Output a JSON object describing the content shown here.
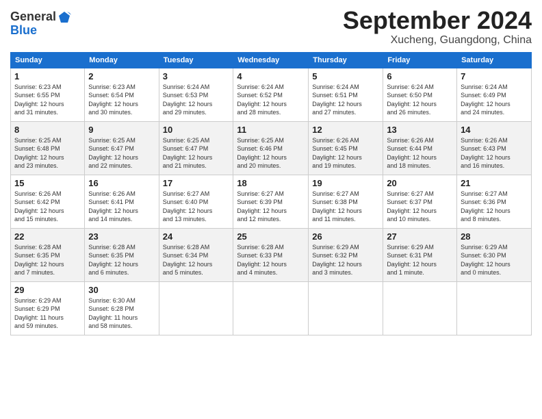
{
  "header": {
    "logo_general": "General",
    "logo_blue": "Blue",
    "month": "September 2024",
    "location": "Xucheng, Guangdong, China"
  },
  "columns": [
    "Sunday",
    "Monday",
    "Tuesday",
    "Wednesday",
    "Thursday",
    "Friday",
    "Saturday"
  ],
  "weeks": [
    [
      {
        "day": "1",
        "info": "Sunrise: 6:23 AM\nSunset: 6:55 PM\nDaylight: 12 hours\nand 31 minutes."
      },
      {
        "day": "2",
        "info": "Sunrise: 6:23 AM\nSunset: 6:54 PM\nDaylight: 12 hours\nand 30 minutes."
      },
      {
        "day": "3",
        "info": "Sunrise: 6:24 AM\nSunset: 6:53 PM\nDaylight: 12 hours\nand 29 minutes."
      },
      {
        "day": "4",
        "info": "Sunrise: 6:24 AM\nSunset: 6:52 PM\nDaylight: 12 hours\nand 28 minutes."
      },
      {
        "day": "5",
        "info": "Sunrise: 6:24 AM\nSunset: 6:51 PM\nDaylight: 12 hours\nand 27 minutes."
      },
      {
        "day": "6",
        "info": "Sunrise: 6:24 AM\nSunset: 6:50 PM\nDaylight: 12 hours\nand 26 minutes."
      },
      {
        "day": "7",
        "info": "Sunrise: 6:24 AM\nSunset: 6:49 PM\nDaylight: 12 hours\nand 24 minutes."
      }
    ],
    [
      {
        "day": "8",
        "info": "Sunrise: 6:25 AM\nSunset: 6:48 PM\nDaylight: 12 hours\nand 23 minutes."
      },
      {
        "day": "9",
        "info": "Sunrise: 6:25 AM\nSunset: 6:47 PM\nDaylight: 12 hours\nand 22 minutes."
      },
      {
        "day": "10",
        "info": "Sunrise: 6:25 AM\nSunset: 6:47 PM\nDaylight: 12 hours\nand 21 minutes."
      },
      {
        "day": "11",
        "info": "Sunrise: 6:25 AM\nSunset: 6:46 PM\nDaylight: 12 hours\nand 20 minutes."
      },
      {
        "day": "12",
        "info": "Sunrise: 6:26 AM\nSunset: 6:45 PM\nDaylight: 12 hours\nand 19 minutes."
      },
      {
        "day": "13",
        "info": "Sunrise: 6:26 AM\nSunset: 6:44 PM\nDaylight: 12 hours\nand 18 minutes."
      },
      {
        "day": "14",
        "info": "Sunrise: 6:26 AM\nSunset: 6:43 PM\nDaylight: 12 hours\nand 16 minutes."
      }
    ],
    [
      {
        "day": "15",
        "info": "Sunrise: 6:26 AM\nSunset: 6:42 PM\nDaylight: 12 hours\nand 15 minutes."
      },
      {
        "day": "16",
        "info": "Sunrise: 6:26 AM\nSunset: 6:41 PM\nDaylight: 12 hours\nand 14 minutes."
      },
      {
        "day": "17",
        "info": "Sunrise: 6:27 AM\nSunset: 6:40 PM\nDaylight: 12 hours\nand 13 minutes."
      },
      {
        "day": "18",
        "info": "Sunrise: 6:27 AM\nSunset: 6:39 PM\nDaylight: 12 hours\nand 12 minutes."
      },
      {
        "day": "19",
        "info": "Sunrise: 6:27 AM\nSunset: 6:38 PM\nDaylight: 12 hours\nand 11 minutes."
      },
      {
        "day": "20",
        "info": "Sunrise: 6:27 AM\nSunset: 6:37 PM\nDaylight: 12 hours\nand 10 minutes."
      },
      {
        "day": "21",
        "info": "Sunrise: 6:27 AM\nSunset: 6:36 PM\nDaylight: 12 hours\nand 8 minutes."
      }
    ],
    [
      {
        "day": "22",
        "info": "Sunrise: 6:28 AM\nSunset: 6:35 PM\nDaylight: 12 hours\nand 7 minutes."
      },
      {
        "day": "23",
        "info": "Sunrise: 6:28 AM\nSunset: 6:35 PM\nDaylight: 12 hours\nand 6 minutes."
      },
      {
        "day": "24",
        "info": "Sunrise: 6:28 AM\nSunset: 6:34 PM\nDaylight: 12 hours\nand 5 minutes."
      },
      {
        "day": "25",
        "info": "Sunrise: 6:28 AM\nSunset: 6:33 PM\nDaylight: 12 hours\nand 4 minutes."
      },
      {
        "day": "26",
        "info": "Sunrise: 6:29 AM\nSunset: 6:32 PM\nDaylight: 12 hours\nand 3 minutes."
      },
      {
        "day": "27",
        "info": "Sunrise: 6:29 AM\nSunset: 6:31 PM\nDaylight: 12 hours\nand 1 minute."
      },
      {
        "day": "28",
        "info": "Sunrise: 6:29 AM\nSunset: 6:30 PM\nDaylight: 12 hours\nand 0 minutes."
      }
    ],
    [
      {
        "day": "29",
        "info": "Sunrise: 6:29 AM\nSunset: 6:29 PM\nDaylight: 11 hours\nand 59 minutes."
      },
      {
        "day": "30",
        "info": "Sunrise: 6:30 AM\nSunset: 6:28 PM\nDaylight: 11 hours\nand 58 minutes."
      },
      null,
      null,
      null,
      null,
      null
    ]
  ]
}
